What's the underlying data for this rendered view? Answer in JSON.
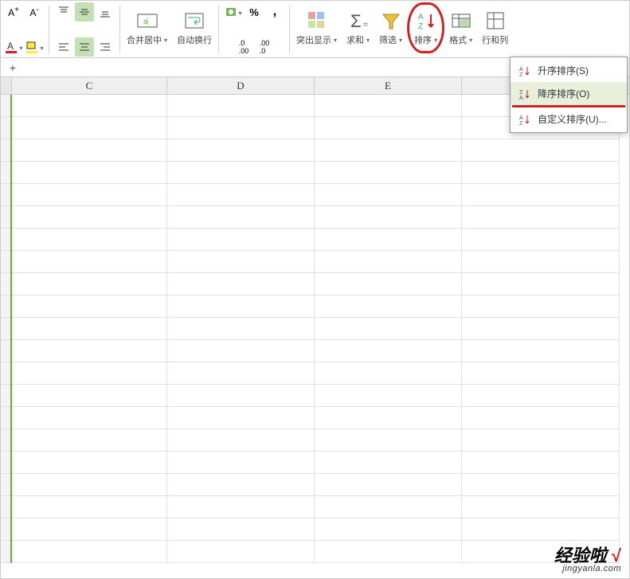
{
  "ribbon": {
    "font_inc": "A⁺",
    "font_dec": "A⁻",
    "merge_label": "合并居中",
    "wrap_label": "自动换行",
    "num_format": "%",
    "comma": ",",
    "dec_inc": ".0 .00",
    "dec_dec": ".00 .0",
    "highlight_label": "突出显示",
    "sum_label": "求和",
    "filter_label": "筛选",
    "sort_label": "排序",
    "format_label": "格式",
    "rowcol_label": "行和列"
  },
  "columns": [
    "C",
    "D",
    "E",
    ""
  ],
  "sort_menu": {
    "asc": "升序排序(S)",
    "desc": "降序排序(O)",
    "custom": "自定义排序(U)..."
  },
  "watermark": {
    "line1": "经验啦",
    "check": "√",
    "line2": "jingyanla.com"
  }
}
